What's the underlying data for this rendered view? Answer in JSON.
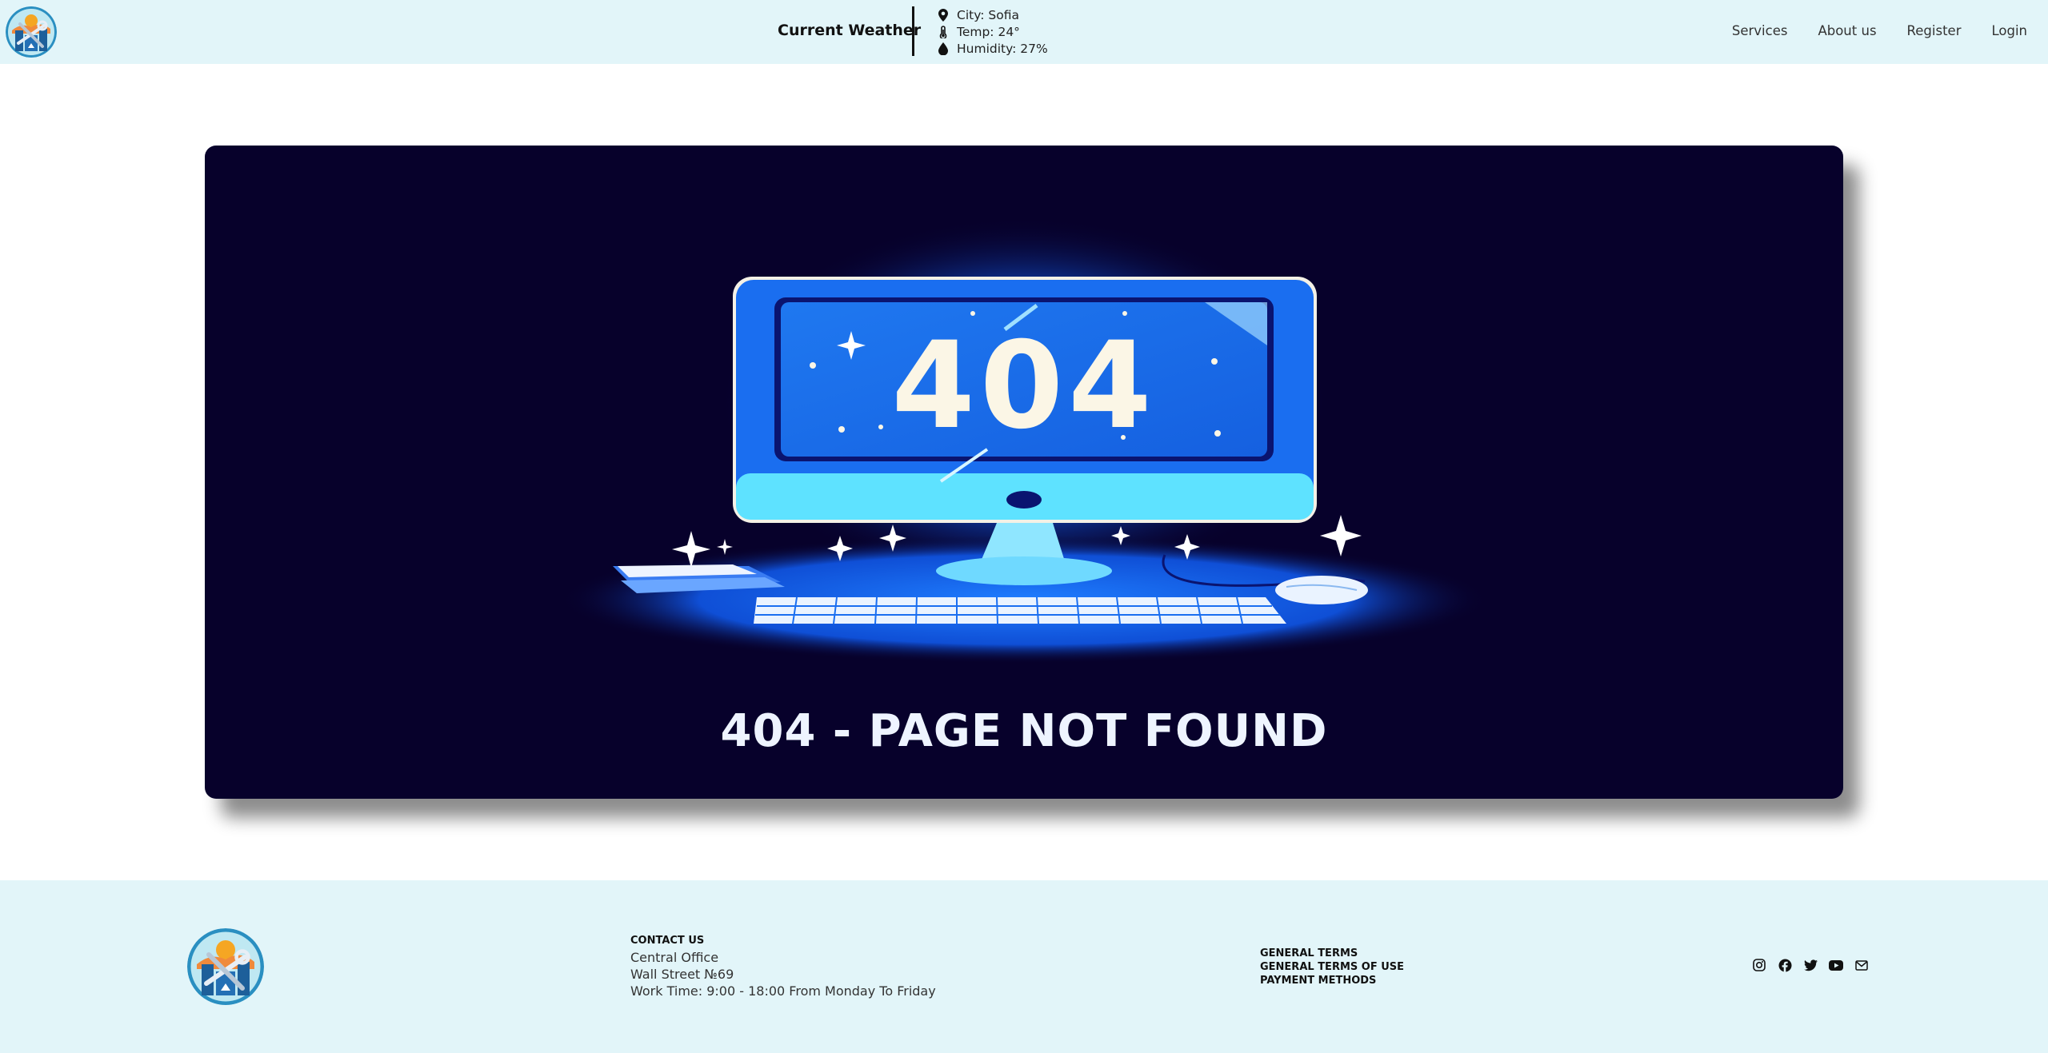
{
  "header": {
    "logo": "city-tools-logo",
    "weather_title": "Current Weather",
    "weather": {
      "city": "City: Sofia",
      "temp": "Temp: 24°",
      "humidity": "Humidity: 27%"
    },
    "nav": {
      "services": "Services",
      "about": "About us",
      "register": "Register",
      "login": "Login"
    }
  },
  "hero": {
    "screen_text": "404",
    "title": "404 - PAGE NOT FOUND"
  },
  "footer": {
    "contact_heading": "CONTACT US",
    "contact_lines": {
      "office": "Central Office",
      "address": "Wall Street №69",
      "hours": "Work Time: 9:00 - 18:00 From Monday To Friday"
    },
    "terms": {
      "general": "GENERAL TERMS",
      "use": "GENERAL TERMS OF USE",
      "payment": "PAYMENT METHODS"
    },
    "social_icons": [
      "instagram-icon",
      "facebook-icon",
      "twitter-icon",
      "youtube-icon",
      "mail-icon"
    ]
  },
  "colors": {
    "header_bg": "#e2f5f9",
    "hero_bg": "#07012b",
    "accent_blue": "#1a6cf0"
  }
}
